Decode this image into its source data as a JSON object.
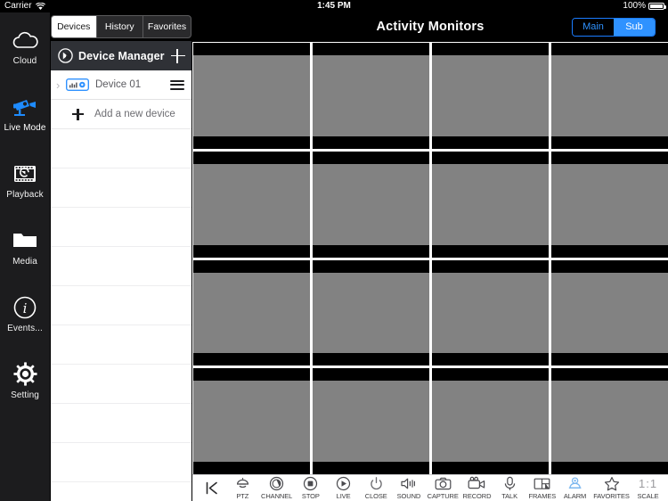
{
  "status_bar": {
    "carrier": "Carrier",
    "wifi_icon": "wifi-icon",
    "time": "1:45 PM",
    "battery_percent": "100%",
    "battery_icon": "battery-full-icon"
  },
  "sidebar": {
    "items": [
      {
        "label": "Cloud",
        "icon": "cloud-icon",
        "active": false
      },
      {
        "label": "Live Mode",
        "icon": "camera-icon",
        "active": true
      },
      {
        "label": "Playback",
        "icon": "playback-icon",
        "active": false
      },
      {
        "label": "Media",
        "icon": "folder-icon",
        "active": false
      },
      {
        "label": "Events...",
        "icon": "info-icon",
        "active": false
      },
      {
        "label": "Setting",
        "icon": "gear-icon",
        "active": false
      }
    ],
    "active_accent": "#1e8bff"
  },
  "panel": {
    "tabs": [
      {
        "label": "Devices",
        "selected": true
      },
      {
        "label": "History",
        "selected": false
      },
      {
        "label": "Favorites",
        "selected": false
      }
    ],
    "header": {
      "title": "Device Manager",
      "icon": "device-manager-icon",
      "add_button": "add-device-plus-button"
    },
    "devices": [
      {
        "name": "Device 01",
        "expand_icon": "chevron-right-icon",
        "device_icon": "nvr-device-icon",
        "menu_icon": "hamburger-menu-icon"
      }
    ],
    "add_device": {
      "label": "Add a new device",
      "icon": "plus-icon"
    },
    "empty_row_count": 9
  },
  "main": {
    "title": "Activity Monitors",
    "stream_toggle": [
      {
        "label": "Main",
        "selected": false
      },
      {
        "label": "Sub",
        "selected": true
      }
    ],
    "accent": "#2f92ff",
    "grid": {
      "columns": 4,
      "rows": 4,
      "cell_count": 16,
      "cell_color": "#828282",
      "letterbox_color": "#000000"
    }
  },
  "toolbar": {
    "back_icon": "skip-back-icon",
    "items": [
      {
        "label": "PTZ",
        "icon": "ptz-dome-icon"
      },
      {
        "label": "CHANNEL",
        "icon": "channel-lens-icon"
      },
      {
        "label": "STOP",
        "icon": "stop-icon"
      },
      {
        "label": "LIVE",
        "icon": "play-icon"
      },
      {
        "label": "CLOSE",
        "icon": "power-icon"
      },
      {
        "label": "SOUND",
        "icon": "speaker-icon"
      },
      {
        "label": "CAPTURE",
        "icon": "camera-photo-icon"
      },
      {
        "label": "RECORD",
        "icon": "video-camera-icon"
      },
      {
        "label": "TALK",
        "icon": "microphone-icon"
      },
      {
        "label": "FRAMES",
        "icon": "frames-layout-icon"
      },
      {
        "label": "ALARM",
        "icon": "alarm-camera-icon",
        "active": true
      },
      {
        "label": "FAVORITES",
        "icon": "star-icon"
      },
      {
        "label": "SCALE",
        "icon": "scale-icon",
        "value": "1:1"
      }
    ]
  }
}
